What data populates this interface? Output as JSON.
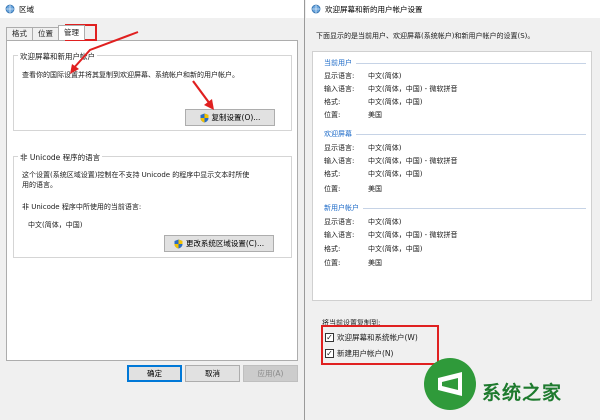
{
  "left_window": {
    "title": "区域",
    "tabs": [
      "格式",
      "位置",
      "管理"
    ],
    "active_tab": "管理",
    "welcome_group": {
      "title": "欢迎屏幕和新用户帐户",
      "description": "查看你的国际设置并将其复制到欢迎屏幕、系统帐户和新的用户帐户。",
      "copy_button": "复制设置(O)..."
    },
    "unicode_group": {
      "title": "非 Unicode 程序的语言",
      "description_line1": "这个设置(系统区域设置)控制在不支持 Unicode 的程序中显示文本时所使",
      "description_line2": "用的语言。",
      "current_label": "非 Unicode 程序中所使用的当前语言:",
      "current_value": "中文(简体，中国)",
      "change_button": "更改系统区域设置(C)..."
    },
    "buttons": {
      "ok": "确定",
      "cancel": "取消",
      "apply": "应用(A)"
    }
  },
  "right_window": {
    "title": "欢迎屏幕和新的用户帐户设置",
    "intro": "下面显示的是当前用户、欢迎屏幕(系统帐户)和新用户帐户的设置(S)。",
    "sections": [
      {
        "heading": "当前用户",
        "rows": [
          {
            "label": "显示语言:",
            "value": "中文(简体)"
          },
          {
            "label": "输入语言:",
            "value": "中文(简体，中国) - 微软拼音"
          },
          {
            "label": "格式:",
            "value": "中文(简体，中国)"
          },
          {
            "label": "位置:",
            "value": "美国"
          }
        ]
      },
      {
        "heading": "欢迎屏幕",
        "rows": [
          {
            "label": "显示语言:",
            "value": "中文(简体)"
          },
          {
            "label": "输入语言:",
            "value": "中文(简体，中国) - 微软拼音"
          },
          {
            "label": "格式:",
            "value": "中文(简体，中国)"
          },
          {
            "label": "位置:",
            "value": "美国"
          }
        ]
      },
      {
        "heading": "新用户帐户",
        "rows": [
          {
            "label": "显示语言:",
            "value": "中文(简体)"
          },
          {
            "label": "输入语言:",
            "value": "中文(简体，中国) - 微软拼音"
          },
          {
            "label": "格式:",
            "value": "中文(简体，中国)"
          },
          {
            "label": "位置:",
            "value": "美国"
          }
        ]
      }
    ],
    "copy_to_label": "将当前设置复制到:",
    "checkboxes": [
      {
        "label": "欢迎屏幕和系统帐户(W)",
        "checked": true
      },
      {
        "label": "新建用户帐户(N)",
        "checked": true
      }
    ]
  },
  "watermark": {
    "text": "系统之家"
  },
  "colors": {
    "highlight": "#e02020",
    "section_heading": "#1e6bc8",
    "default_button_border": "#0078d7"
  }
}
